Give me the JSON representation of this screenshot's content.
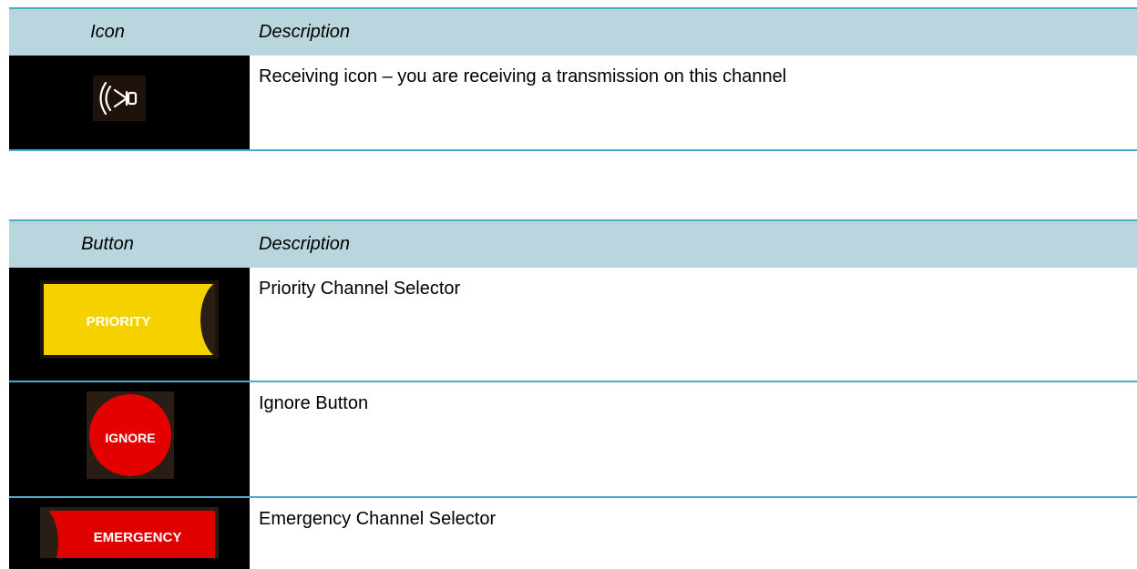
{
  "icon_table": {
    "header": {
      "col1": "Icon",
      "col2": "Description"
    },
    "rows": [
      {
        "icon": "speaker-receiving-icon",
        "description": "Receiving icon – you are receiving a transmission on this channel"
      }
    ]
  },
  "button_table": {
    "header": {
      "col1": "Button",
      "col2": "Description"
    },
    "rows": [
      {
        "button_label": "PRIORITY",
        "description": "Priority Channel Selector",
        "color": "#f6d100"
      },
      {
        "button_label": "IGNORE",
        "description": "Ignore Button",
        "color": "#e50000"
      },
      {
        "button_label": "EMERGENCY",
        "description": "Emergency Channel Selector",
        "color": "#e00000"
      }
    ]
  },
  "colors": {
    "header_bg": "#b9d6df",
    "rule": "#4bacc6",
    "image_bg": "#000000"
  }
}
